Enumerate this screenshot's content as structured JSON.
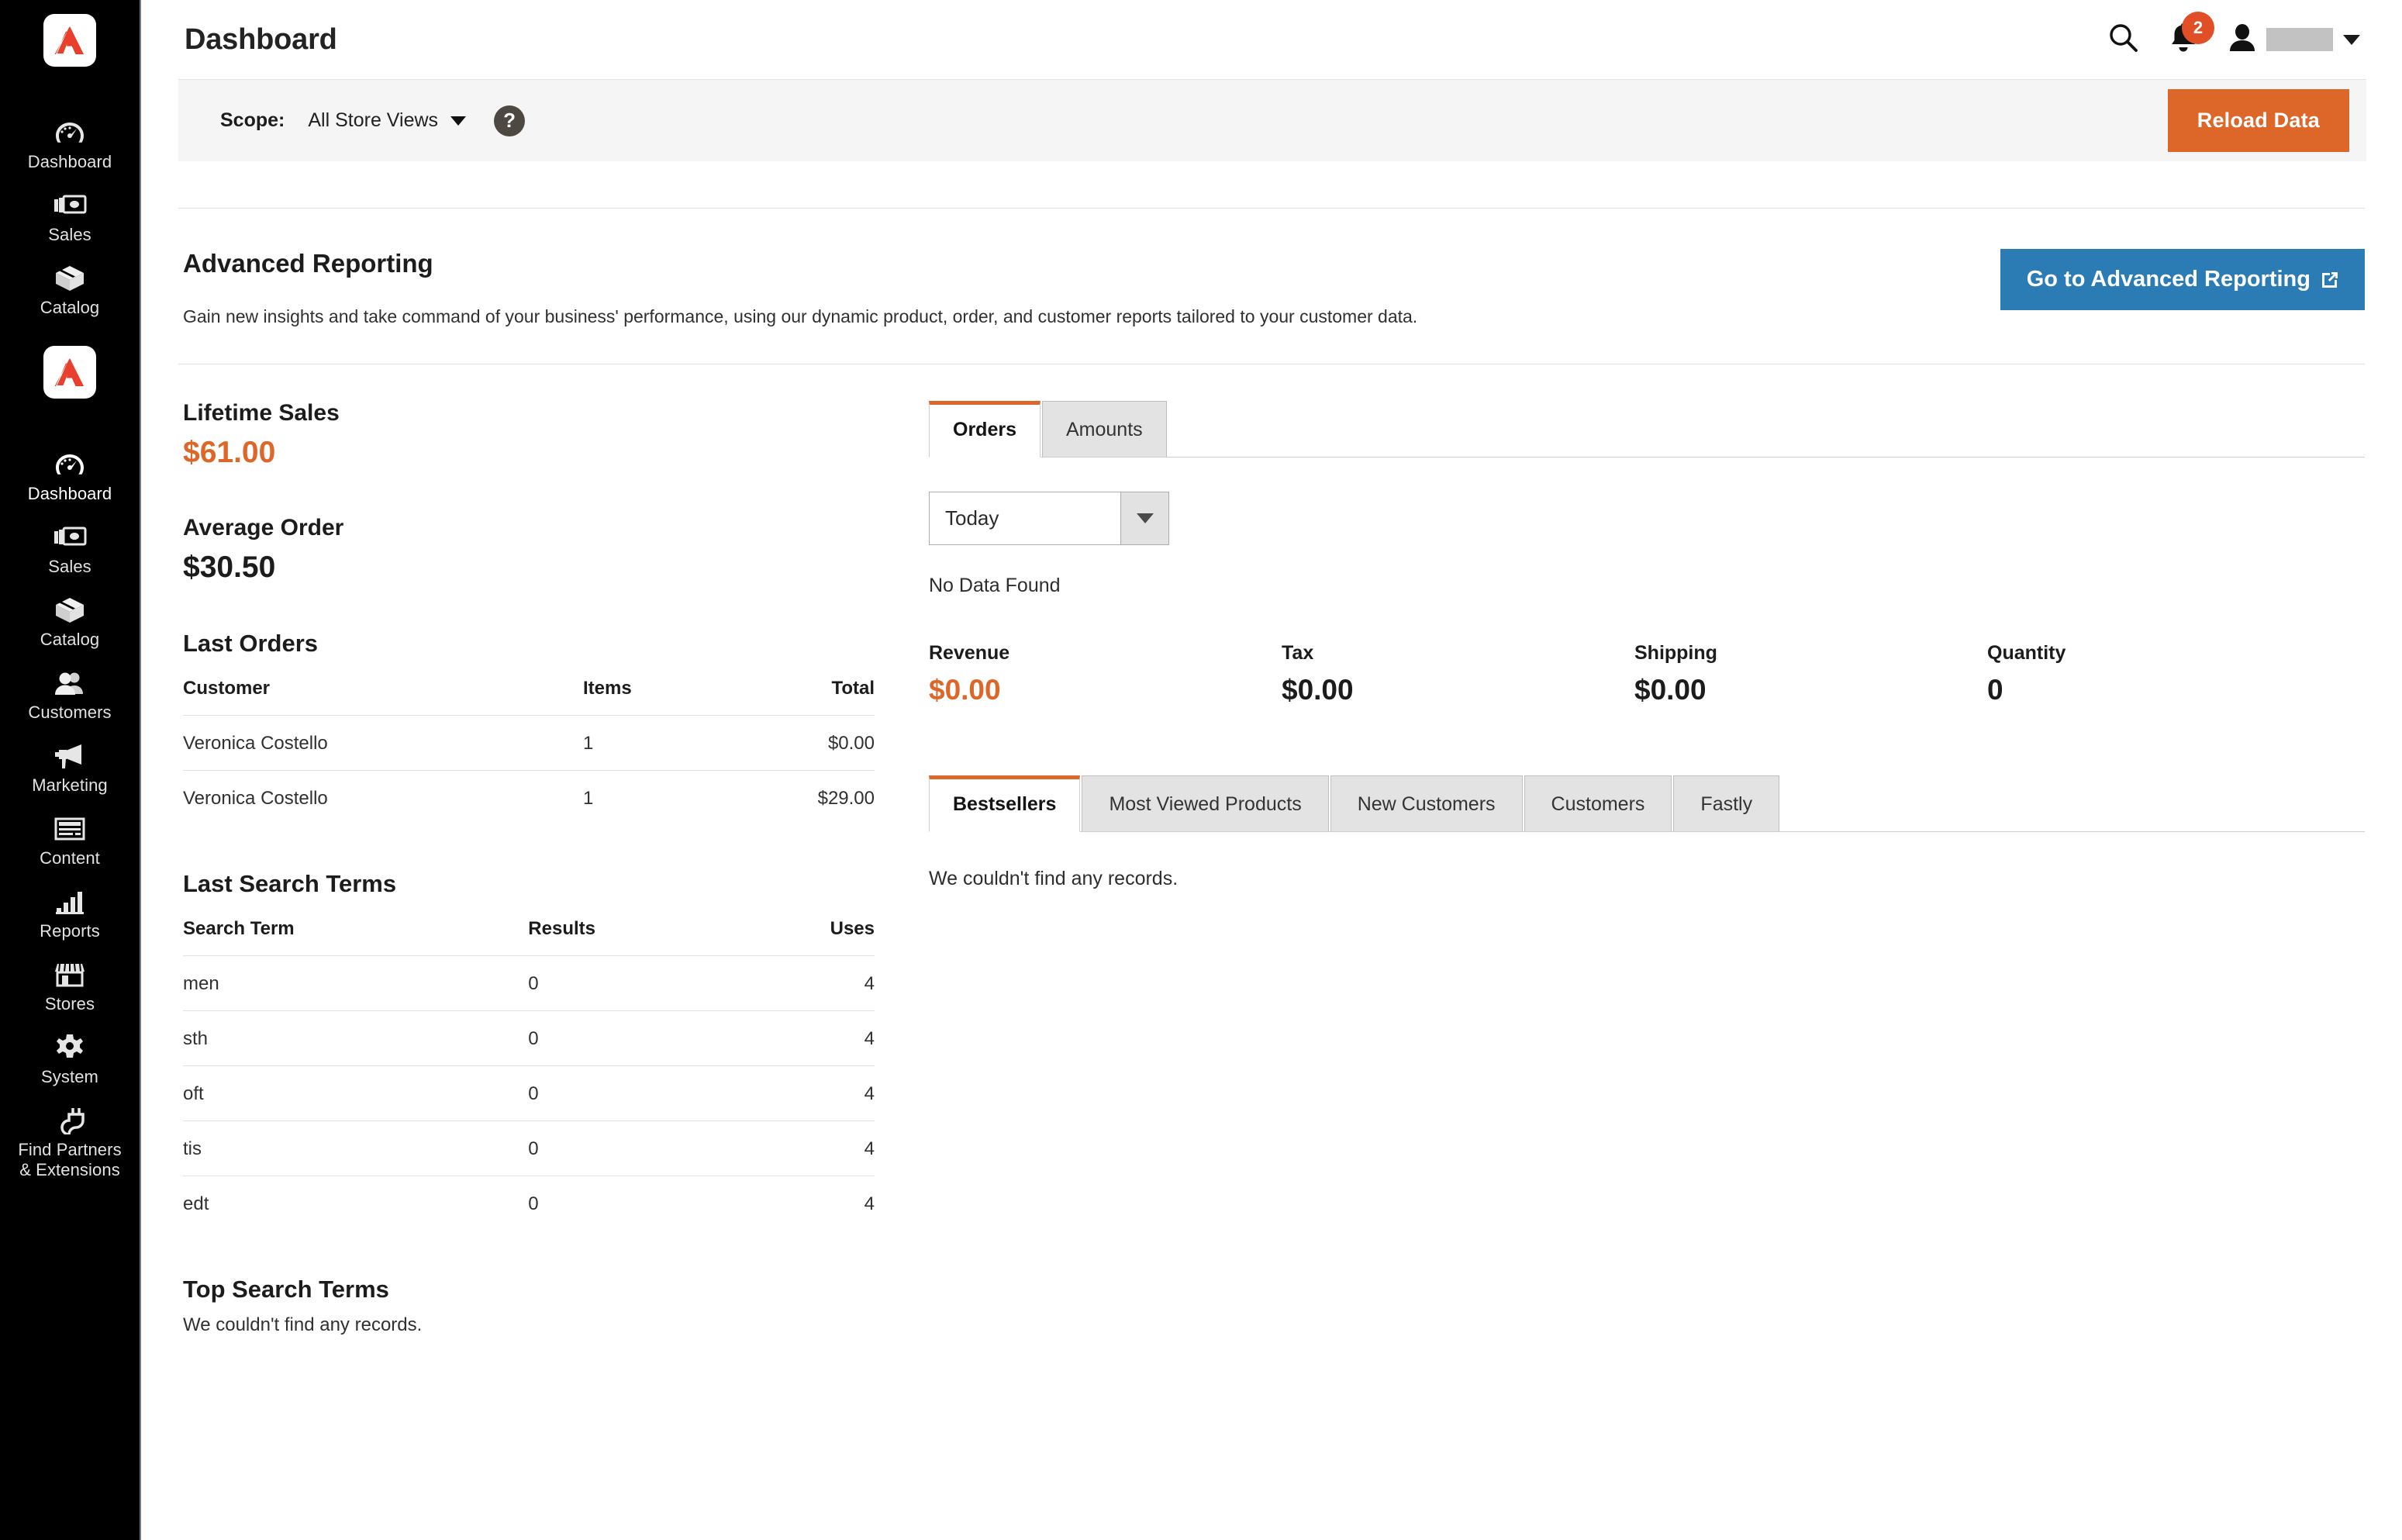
{
  "sidebar": {
    "brand_icon": "adobe-logo-icon",
    "items": [
      {
        "label": "Dashboard",
        "icon": "dashboard-gauge-icon",
        "active": false
      },
      {
        "label": "Sales",
        "icon": "money-bills-icon",
        "active": false
      },
      {
        "label": "Catalog",
        "icon": "box-icon",
        "active": false
      },
      {
        "label": "Dashboard",
        "icon": "dashboard-gauge-icon",
        "active": true
      },
      {
        "label": "Sales",
        "icon": "money-bills-icon",
        "active": false
      },
      {
        "label": "Catalog",
        "icon": "box-icon",
        "active": false
      },
      {
        "label": "Customers",
        "icon": "people-icon",
        "active": false
      },
      {
        "label": "Marketing",
        "icon": "megaphone-icon",
        "active": false
      },
      {
        "label": "Content",
        "icon": "content-page-icon",
        "active": false
      },
      {
        "label": "Reports",
        "icon": "bar-chart-icon",
        "active": false
      },
      {
        "label": "Stores",
        "icon": "storefront-icon",
        "active": false
      },
      {
        "label": "System",
        "icon": "gear-icon",
        "active": false
      },
      {
        "label": "Find Partners\n& Extensions",
        "icon": "plug-icon",
        "active": false
      }
    ]
  },
  "header": {
    "title": "Dashboard",
    "search_icon": "search-icon",
    "notifications_icon": "bell-icon",
    "notifications_count": "2",
    "account_icon": "user-avatar-icon",
    "account_name": "",
    "account_caret_icon": "chevron-down-icon"
  },
  "scope_bar": {
    "label": "Scope:",
    "value": "All Store Views",
    "caret_icon": "chevron-down-icon",
    "help_icon": "?",
    "reload_label": "Reload Data"
  },
  "advanced_reporting": {
    "title": "Advanced Reporting",
    "description": "Gain new insights and take command of your business' performance, using our dynamic product, order, and customer reports tailored to your customer data.",
    "button_label": "Go to Advanced Reporting",
    "button_external_icon": "external-link-icon"
  },
  "left_column": {
    "lifetime_sales": {
      "title": "Lifetime Sales",
      "value": "$61.00"
    },
    "average_order": {
      "title": "Average Order",
      "value": "$30.50"
    },
    "last_orders": {
      "title": "Last Orders",
      "columns": [
        "Customer",
        "Items",
        "Total"
      ],
      "rows": [
        {
          "customer": "Veronica Costello",
          "items": "1",
          "total": "$0.00"
        },
        {
          "customer": "Veronica Costello",
          "items": "1",
          "total": "$29.00"
        }
      ]
    },
    "last_search_terms": {
      "title": "Last Search Terms",
      "columns": [
        "Search Term",
        "Results",
        "Uses"
      ],
      "rows": [
        {
          "term": "men",
          "results": "0",
          "uses": "4"
        },
        {
          "term": "sth",
          "results": "0",
          "uses": "4"
        },
        {
          "term": "oft",
          "results": "0",
          "uses": "4"
        },
        {
          "term": "tis",
          "results": "0",
          "uses": "4"
        },
        {
          "term": "edt",
          "results": "0",
          "uses": "4"
        }
      ]
    },
    "top_search_terms": {
      "title": "Top Search Terms",
      "empty_message": "We couldn't find any records."
    }
  },
  "right_column": {
    "chart_tabs": [
      {
        "label": "Orders",
        "selected": true
      },
      {
        "label": "Amounts",
        "selected": false
      }
    ],
    "period_select": {
      "value": "Today",
      "caret_icon": "chevron-down-icon"
    },
    "no_data_message": "No Data Found",
    "kpis": [
      {
        "label": "Revenue",
        "value": "$0.00",
        "accent": true
      },
      {
        "label": "Tax",
        "value": "$0.00",
        "accent": false
      },
      {
        "label": "Shipping",
        "value": "$0.00",
        "accent": false
      },
      {
        "label": "Quantity",
        "value": "0",
        "accent": false
      }
    ],
    "bottom_tabs": [
      {
        "label": "Bestsellers",
        "selected": true
      },
      {
        "label": "Most Viewed Products",
        "selected": false
      },
      {
        "label": "New Customers",
        "selected": false
      },
      {
        "label": "Customers",
        "selected": false
      },
      {
        "label": "Fastly",
        "selected": false
      }
    ],
    "bottom_empty_message": "We couldn't find any records."
  },
  "colors": {
    "accent_orange": "#dd6629",
    "link_blue": "#2b7cb5",
    "badge_red": "#e04f25",
    "sidebar_bg": "#000000"
  }
}
